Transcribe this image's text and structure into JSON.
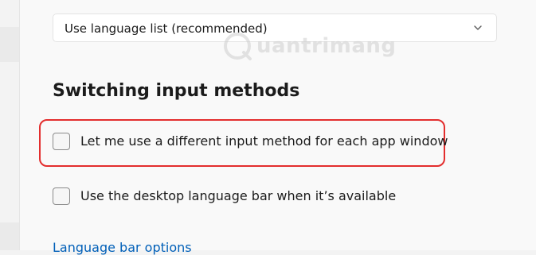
{
  "language_preference": {
    "dropdown_value": "Use language list (recommended)"
  },
  "watermark": {
    "text": "uantrimang"
  },
  "switching_input_methods": {
    "heading": "Switching input methods",
    "options": [
      {
        "label": "Let me use a different input method for each app window",
        "checked": false
      },
      {
        "label": "Use the desktop language bar when it’s available",
        "checked": false
      }
    ],
    "link": "Language bar options"
  },
  "colors": {
    "highlight_border": "#e32e2e",
    "link": "#005fb8",
    "pane_background": "#f9f9f9"
  }
}
